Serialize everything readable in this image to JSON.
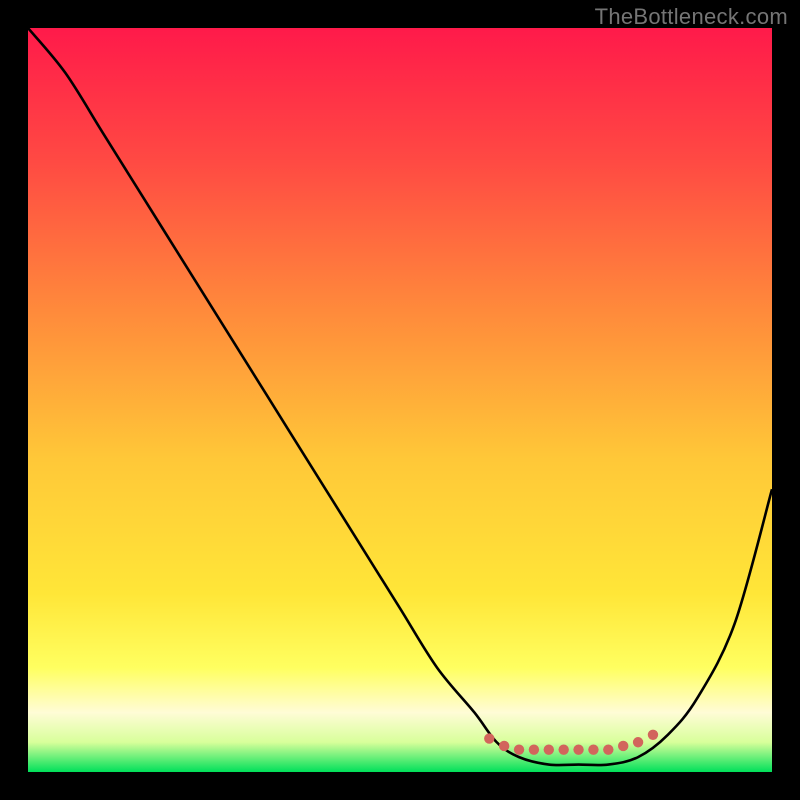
{
  "watermark": "TheBottleneck.com",
  "colors": {
    "frame": "#000000",
    "curve": "#000000",
    "dots": "#d2655c",
    "gradient_top": "#ff1a4a",
    "gradient_mid1": "#ff6a3a",
    "gradient_mid2": "#ffd438",
    "gradient_mid3": "#ffff60",
    "gradient_mid4": "#fffcd6",
    "gradient_bottom": "#00e05a"
  },
  "chart_data": {
    "type": "line",
    "title": "",
    "xlabel": "",
    "ylabel": "",
    "xlim": [
      0,
      100
    ],
    "ylim": [
      0,
      100
    ],
    "series": [
      {
        "name": "bottleneck-curve",
        "x": [
          0,
          5,
          10,
          15,
          20,
          25,
          30,
          35,
          40,
          45,
          50,
          55,
          60,
          63,
          66,
          70,
          74,
          78,
          82,
          86,
          90,
          95,
          100
        ],
        "values": [
          100,
          94,
          86,
          78,
          70,
          62,
          54,
          46,
          38,
          30,
          22,
          14,
          8,
          4,
          2,
          1,
          1,
          1,
          2,
          5,
          10,
          20,
          38
        ]
      }
    ],
    "dots": {
      "name": "optimal-zone",
      "x": [
        62,
        64,
        66,
        68,
        70,
        72,
        74,
        76,
        78,
        80,
        82,
        84
      ],
      "values": [
        4.5,
        3.5,
        3,
        3,
        3,
        3,
        3,
        3,
        3,
        3.5,
        4,
        5
      ]
    }
  }
}
